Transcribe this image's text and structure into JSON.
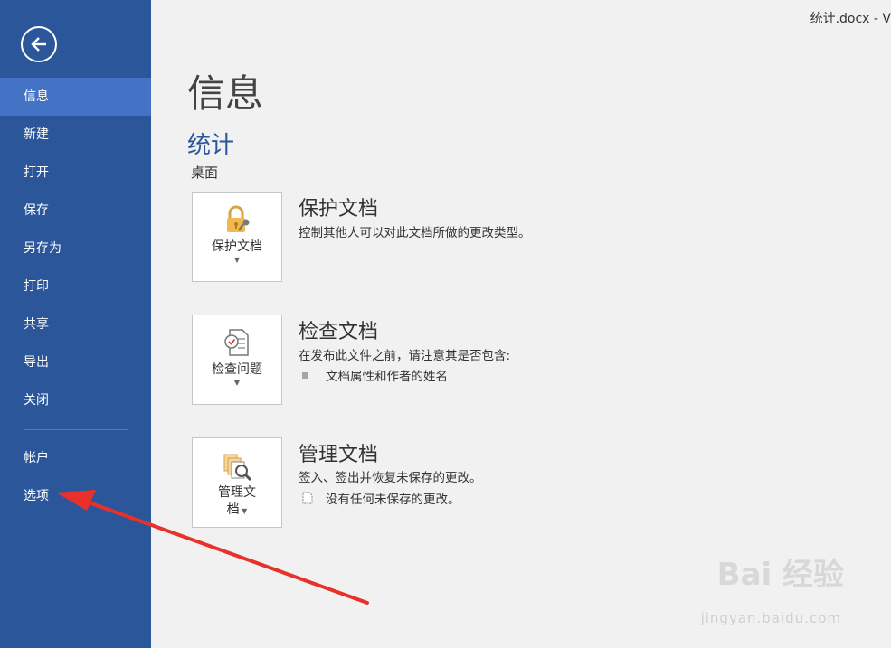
{
  "window": {
    "title": "统计.docx - V"
  },
  "sidebar": {
    "items": [
      {
        "label": "信息",
        "active": true
      },
      {
        "label": "新建"
      },
      {
        "label": "打开"
      },
      {
        "label": "保存"
      },
      {
        "label": "另存为"
      },
      {
        "label": "打印"
      },
      {
        "label": "共享"
      },
      {
        "label": "导出"
      },
      {
        "label": "关闭"
      },
      {
        "label": "帐户"
      },
      {
        "label": "选项"
      }
    ]
  },
  "main": {
    "page_title": "信息",
    "doc_name": "统计",
    "doc_location": "桌面",
    "protect": {
      "button_label": "保护文档",
      "title": "保护文档",
      "description": "控制其他人可以对此文档所做的更改类型。"
    },
    "inspect": {
      "button_label": "检查问题",
      "title": "检查文档",
      "description": "在发布此文件之前，请注意其是否包含:",
      "bullet": "文档属性和作者的姓名"
    },
    "manage": {
      "button_label_1": "管理文",
      "button_label_2": "档",
      "title": "管理文档",
      "description": "签入、签出并恢复未保存的更改。",
      "bullet": "没有任何未保存的更改。"
    }
  },
  "watermark": {
    "brand": "Bai 经验",
    "url": "jingyan.baidu.com"
  },
  "colors": {
    "sidebar": "#2b579a",
    "sidebar_active": "#4472c4",
    "accent": "#2b579a",
    "annotation": "#e8312a"
  },
  "icons": [
    "back-arrow-icon",
    "lock-key-icon",
    "inspect-doc-icon",
    "manage-versions-icon",
    "caret-down-icon",
    "document-icon"
  ]
}
